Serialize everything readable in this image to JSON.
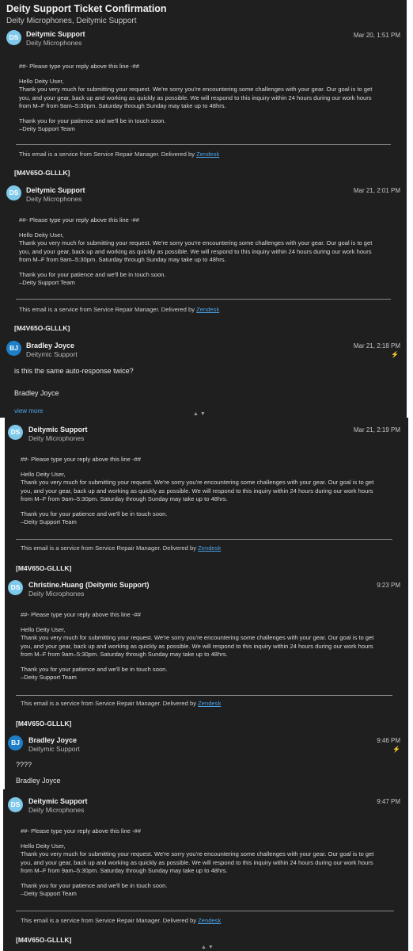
{
  "thread": {
    "title": "Deity Support Ticket Confirmation",
    "subtitle": "Deity Microphones, Deitymic Support"
  },
  "auto_body": {
    "reply_marker": "##- Please type your reply above this line -##",
    "greeting": "Hello Deity User,",
    "line1": "Thank you very much for submitting your request. We're sorry you're encountering some challenges with your gear. Our goal is to get",
    "line2": "you, and your gear, back up and working as quickly as possible. We will respond to this inquiry within 24 hours during our work hours",
    "line3": "from M–F from 9am–5:30pm. Saturday through Sunday may take up to 48hrs.",
    "closing": "Thank you for your patience and we'll be in touch soon.",
    "signature": "–Deity Support Team",
    "footer_prefix": "This email is a service from Service Repair Manager. Delivered by ",
    "footer_link": "Zendesk",
    "ticket_id": "[M4V65O-GLLLK]"
  },
  "messages": [
    {
      "initials": "DS",
      "sender": "Deitymic Support",
      "org": "Deity Microphones",
      "time": "Mar 20, 1:51 PM"
    },
    {
      "initials": "DS",
      "sender": "Deitymic Support",
      "org": "Deity Microphones",
      "time": "Mar 21, 2:01 PM"
    },
    {
      "initials": "BJ",
      "sender": "Bradley Joyce",
      "org": "Deitymic Support",
      "time": "Mar 21, 2:18 PM",
      "text": "is this the same auto-response twice?",
      "signoff": "Bradley Joyce"
    },
    {
      "initials": "DS",
      "sender": "Deitymic Support",
      "org": "Deity Microphones",
      "time": "Mar 21, 2:19 PM"
    },
    {
      "initials": "DS",
      "sender": "Christine.Huang (Deitymic Support)",
      "org": "Deity Microphones",
      "time": "9:23 PM"
    },
    {
      "initials": "BJ",
      "sender": "Bradley Joyce",
      "org": "Deitymic Support",
      "time": "9:46 PM",
      "text": "????",
      "signoff": "Bradley Joyce"
    },
    {
      "initials": "DS",
      "sender": "Deitymic Support",
      "org": "Deity Microphones",
      "time": "9:47 PM"
    }
  ],
  "view_more": "view more",
  "colors": {
    "background": "#1f1f1f",
    "link": "#4aa3e8",
    "avatar_ds": "#7ec8ea",
    "avatar_bj": "#1e7fc8"
  },
  "icons": {
    "bolt": "lightning-bolt-icon",
    "arrows": "collapse-expand-arrows-icon"
  }
}
